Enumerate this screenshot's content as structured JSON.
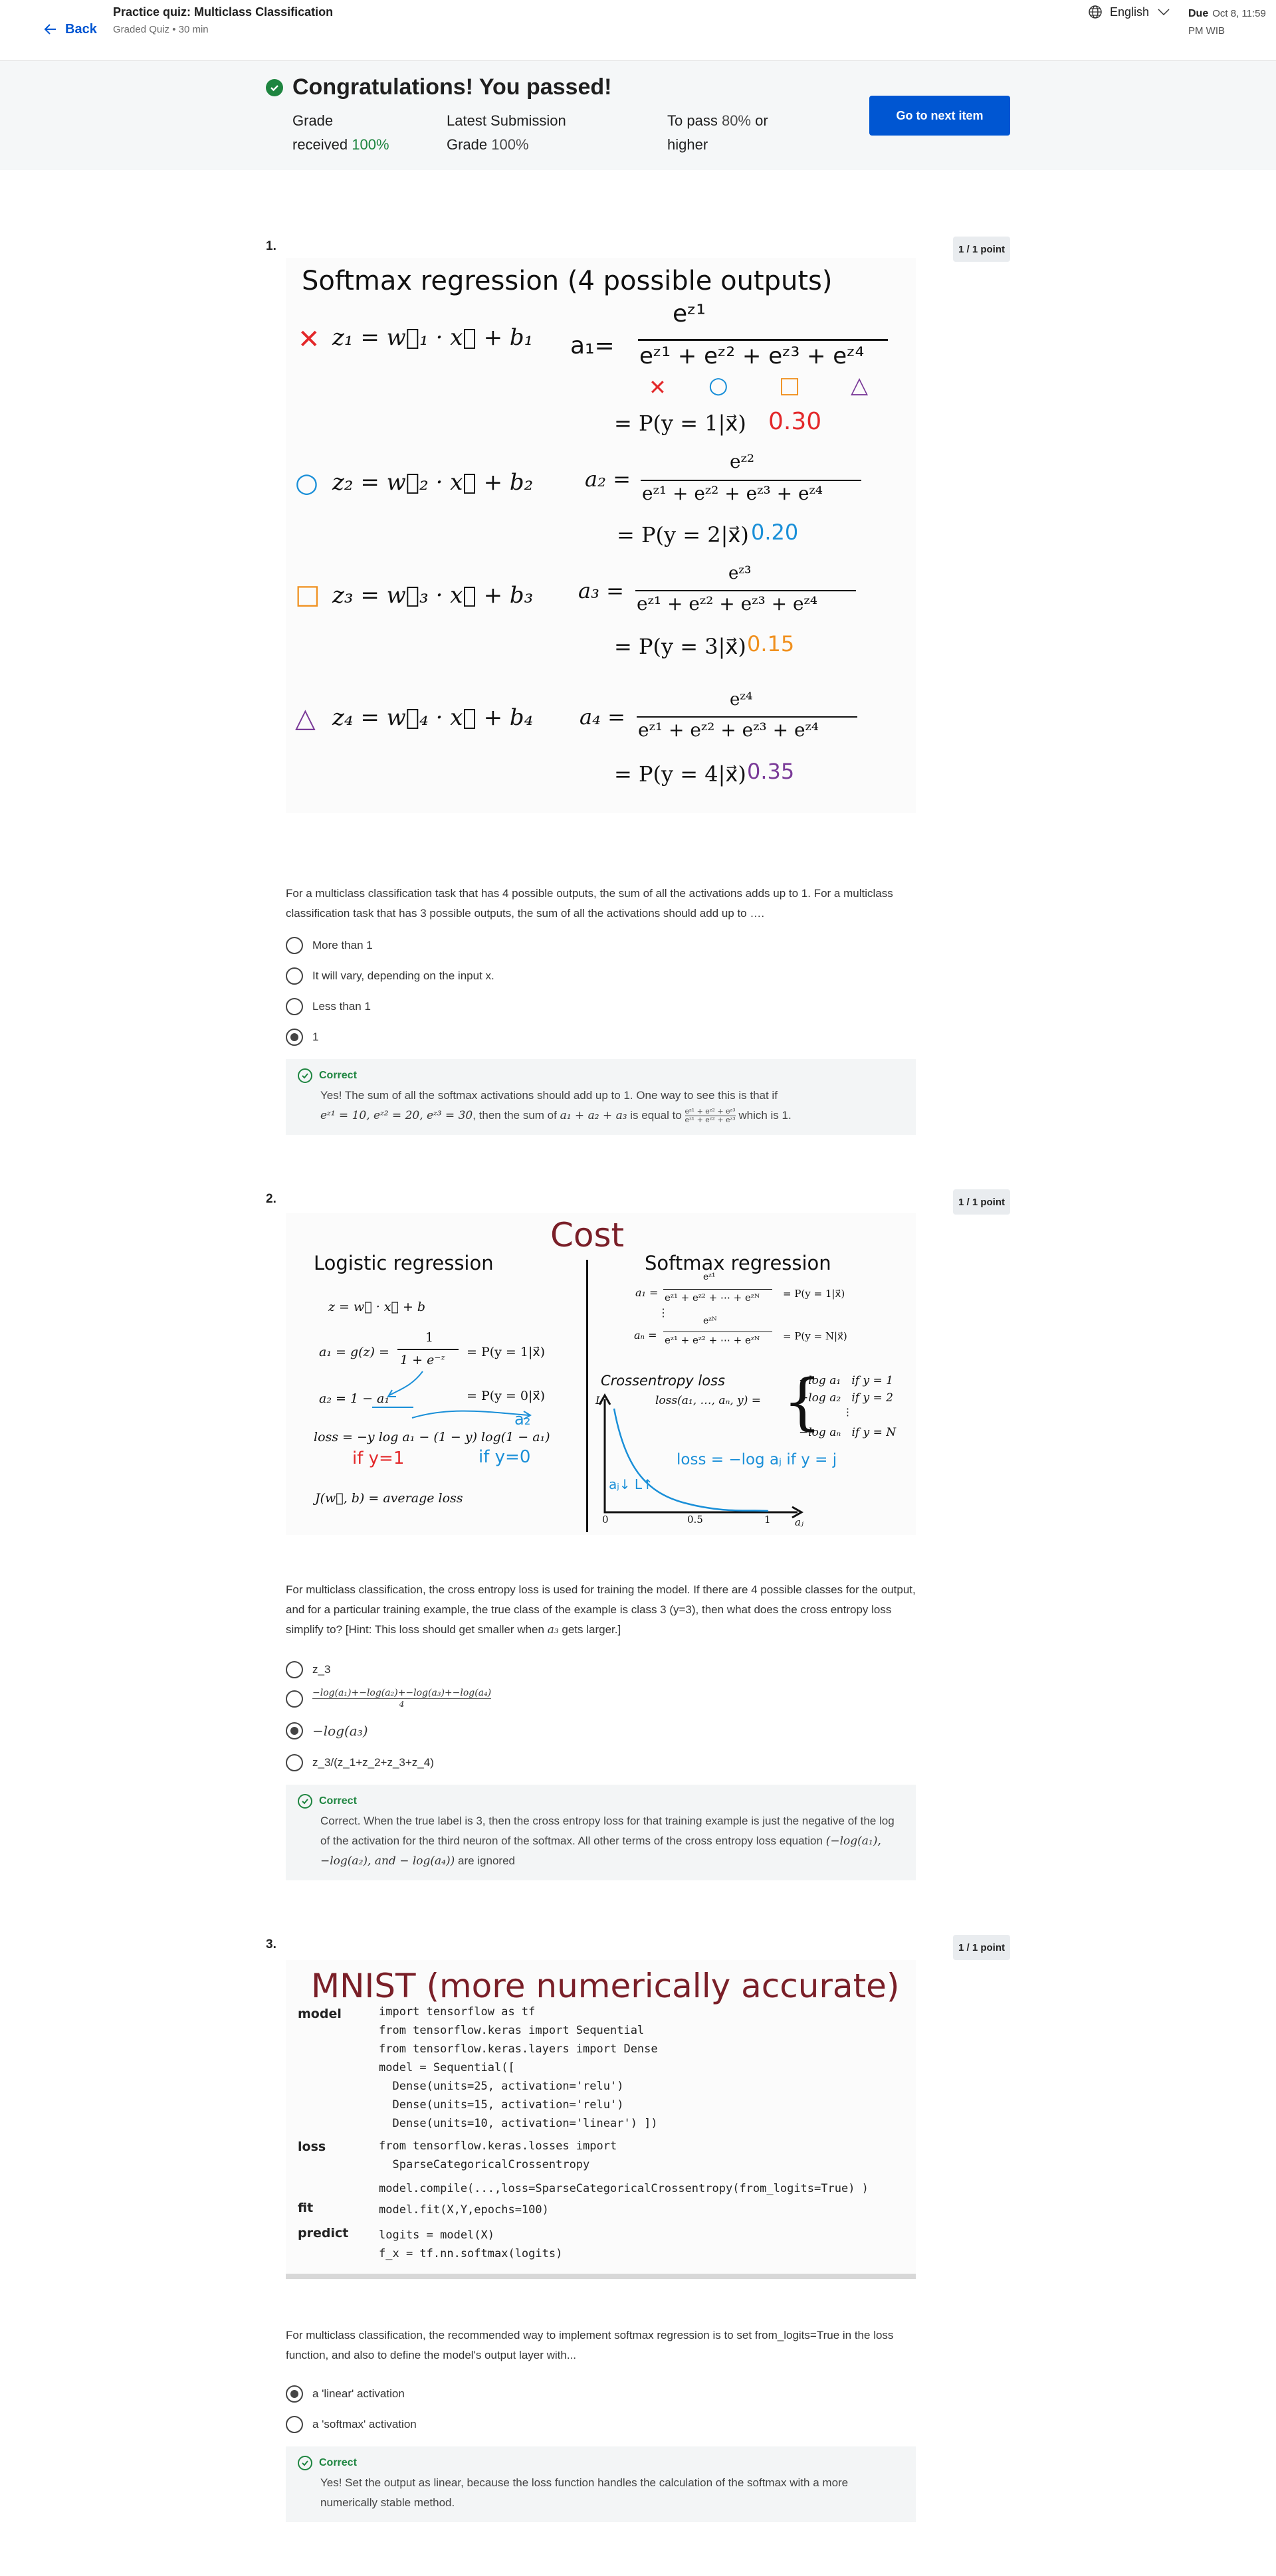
{
  "header": {
    "back_label": "Back",
    "quiz_title": "Practice quiz: Multiclass Classification",
    "quiz_subtitle": "Graded Quiz • 30 min",
    "language": "English",
    "due_label": "Due",
    "due_date": "Oct 8, 11:59 PM WIB"
  },
  "banner": {
    "title": "Congratulations! You passed!",
    "grade_label_1": "Grade",
    "grade_label_2": "received",
    "grade_value": "100%",
    "latest_label_1": "Latest Submission",
    "latest_label_2": "Grade",
    "latest_value": "100%",
    "topass_label_1": "To pass",
    "topass_value": "80%",
    "topass_label_2": "or",
    "topass_label_3": "higher",
    "next_button": "Go to next item"
  },
  "q1": {
    "number": "1.",
    "points": "1 / 1 point",
    "figure": {
      "title": "Softmax regression (4 possible outputs)",
      "z1": "z₁ = w⃗₁ · x⃗ + b₁",
      "z2": "z₂ = w⃗₂ · x⃗ + b₂",
      "z3": "z₃ = w⃗₃ · x⃗ + b₃",
      "z4": "z₄ = w⃗₄ · x⃗ + b₄",
      "a1_lhs": "a₁=",
      "a1_num": "eᶻ¹",
      "a1_den": "eᶻ¹ + eᶻ² + eᶻ³ + eᶻ⁴",
      "p1": "= P(y = 1|x⃗)",
      "p1_val": "0.30",
      "a2_lhs": "a₂ =",
      "a2_num": "eᶻ²",
      "a2_den": "eᶻ¹ + eᶻ² + eᶻ³ + eᶻ⁴",
      "p2": "= P(y = 2|x⃗)",
      "p2_val": "0.20",
      "a3_lhs": "a₃ =",
      "a3_num": "eᶻ³",
      "a3_den": "eᶻ¹ + eᶻ² + eᶻ³ + eᶻ⁴",
      "p3": "= P(y = 3|x⃗)",
      "p3_val": "0.15",
      "a4_lhs": "a₄ =",
      "a4_num": "eᶻ⁴",
      "a4_den": "eᶻ¹ + eᶻ² + eᶻ³ + eᶻ⁴",
      "p4": "= P(y = 4|x⃗)",
      "p4_val": "0.35",
      "sym_x": "✕",
      "sym_o": "○",
      "sym_sq": "□",
      "sym_tri": "△"
    },
    "prompt": "For a multiclass classification task that has 4 possible outputs, the sum of all the activations adds up to 1. For a multiclass classification task that has 3 possible outputs, the sum of all the activations should add up to ….",
    "options": [
      "More than 1",
      "It will vary, depending on the input x.",
      "Less than 1",
      "1"
    ],
    "selected": 3,
    "feedback_label": "Correct",
    "feedback_1": "Yes! The sum of all the softmax activations should add up to 1. One way to see this is that if",
    "feedback_math_1": "eᶻ¹ = 10, eᶻ² = 20, eᶻ³ = 30",
    "feedback_2": ", then the sum of",
    "feedback_math_2": "a₁ + a₂ + a₃",
    "feedback_3": "is equal to",
    "feedback_frac_top": "eᶻ¹ + eᶻ² + eᶻ³",
    "feedback_frac_bot": "eᶻ¹ + eᶻ² + eᶻ³",
    "feedback_4": "which is 1."
  },
  "q2": {
    "number": "2.",
    "points": "1 / 1 point",
    "figure": {
      "title": "Cost",
      "left_title": "Logistic regression",
      "right_title": "Softmax regression",
      "l1": "z = w⃗ · x⃗ + b",
      "l2_lhs": "a₁ = g(z) =",
      "l2_num": "1",
      "l2_den": "1 + e⁻ᶻ",
      "l2_rhs": "= P(y = 1|x⃗)",
      "l3": "a₂ = 1 − a₁",
      "l3_rhs": "= P(y = 0|x⃗)",
      "l4": "loss = −y log a₁ − (1 − y) log(1 − a₁)",
      "l4_hand_a": "if y=1",
      "l4_hand_b": "if y=0",
      "l4_hand_c": "a₂",
      "l5": "J(w⃗, b) = average loss",
      "r1_lhs": "a₁ =",
      "r1_num": "eᶻ¹",
      "r1_den": "eᶻ¹ + eᶻ² + ⋯ + eᶻᴺ",
      "r1_rhs": "= P(y = 1|x⃗)",
      "r_dots": "⋮",
      "r2_lhs": "aₙ =",
      "r2_num": "eᶻᴺ",
      "r2_den": "eᶻ¹ + eᶻ² + ⋯ + eᶻᴺ",
      "r2_rhs": "= P(y = N|x⃗)",
      "ce_title": "Crossentropy loss",
      "ce_lhs": "loss(a₁, …, aₙ, y) =",
      "ce_c1": "−log a₁   if y = 1",
      "ce_c2": "−log a₂   if y = 2",
      "ce_dots": "⋮",
      "ce_cn": "−log aₙ   if y = N",
      "axis_l": "L",
      "axis_0": "0",
      "axis_05": "0.5",
      "axis_1": "1",
      "axis_aj": "aⱼ",
      "hand_loss": "loss = −log aⱼ  if y = j",
      "hand_aj": "aⱼ↓ L↑"
    },
    "prompt_1": "For multiclass classification, the cross entropy loss is used for training the model. If there are 4 possible classes for the output, and for a particular training example, the true class of the example is class 3 (y=3), then what does the cross entropy loss simplify to? [Hint: This loss should get smaller when",
    "prompt_math": "a₃",
    "prompt_2": "gets larger.]",
    "options": [
      "z_3",
      "−log(a₁)+−log(a₂)+−log(a₃)+−log(a₄)",
      "−log(a₃)",
      "z_3/(z_1+z_2+z_3+z_4)"
    ],
    "option2_den": "4",
    "selected": 2,
    "feedback_label": "Correct",
    "feedback_1": "Correct. When the true label is 3, then the cross entropy loss for that training example is just the negative of the log of the activation for the third neuron of the softmax. All other terms of the cross entropy loss equation",
    "feedback_math": "(−log(a₁), −log(a₂), and − log(a₄))",
    "feedback_2": "are ignored"
  },
  "q3": {
    "number": "3.",
    "points": "1 / 1 point",
    "figure": {
      "title": "MNIST (more numerically accurate)",
      "label_model": "model",
      "label_loss": "loss",
      "label_fit": "fit",
      "label_predict": "predict",
      "code_model": "import tensorflow as tf\nfrom tensorflow.keras import Sequential\nfrom tensorflow.keras.layers import Dense\nmodel = Sequential([\n  Dense(units=25, activation='relu')\n  Dense(units=15, activation='relu')\n  Dense(units=10, activation='linear') ])",
      "code_loss": "from tensorflow.keras.losses import\n  SparseCategoricalCrossentropy",
      "code_compile": "model.compile(...,loss=SparseCategoricalCrossentropy(from_logits=True) )",
      "code_fit": "model.fit(X,Y,epochs=100)",
      "code_predict": "logits = model(X)\nf_x = tf.nn.softmax(logits)"
    },
    "prompt": "For multiclass classification, the recommended way to implement softmax regression is to set from_logits=True in the loss function, and also to define the model's output layer with...",
    "options": [
      "a 'linear' activation",
      "a 'softmax' activation"
    ],
    "selected": 0,
    "feedback_label": "Correct",
    "feedback_1": "Yes! Set the output as linear, because the loss function handles the calculation of the softmax with a more numerically stable method."
  },
  "colors": {
    "brand_blue": "#0056d2",
    "success_green": "#1e8540",
    "red": "#e3282a",
    "blue": "#1a8fd8",
    "orange": "#f0901e",
    "purple": "#7a3a98",
    "maroon": "#7a1f28"
  }
}
